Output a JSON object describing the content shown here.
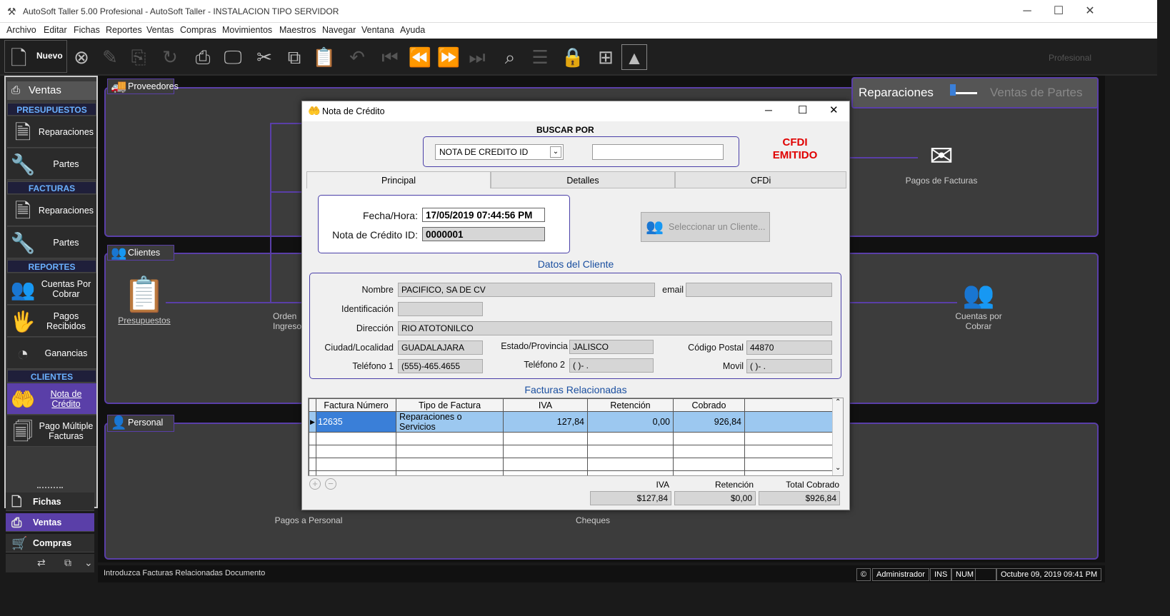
{
  "window": {
    "title": "AutoSoft Taller 5.00 Profesional - AutoSoft Taller - INSTALACION TIPO SERVIDOR",
    "minimize": "─",
    "maximize": "☐",
    "close": "✕"
  },
  "menu": [
    "Archivo",
    "Editar",
    "Fichas",
    "Reportes",
    "Ventas",
    "Compras",
    "Movimientos",
    "Maestros",
    "Navegar",
    "Ventana",
    "Ayuda"
  ],
  "toolbar": {
    "new_label": "Nuevo",
    "brand": "Profesional"
  },
  "sidebar": {
    "header": "Ventas",
    "sections": {
      "presupuestos": "PRESUPUESTOS",
      "facturas": "FACTURAS",
      "reportes": "REPORTES",
      "clientes": "CLIENTES"
    },
    "items": {
      "pres_reparaciones": "Reparaciones",
      "pres_partes": "Partes",
      "fact_reparaciones": "Reparaciones",
      "fact_partes": "Partes",
      "cuentas_cobrar": "Cuentas Por Cobrar",
      "pagos_recibidos": "Pagos Recibidos",
      "ganancias": "Ganancias",
      "nota_credito": "Nota de Crédito",
      "pago_multiple": "Pago Múltiple Facturas"
    },
    "bottom": {
      "fichas": "Fichas",
      "ventas": "Ventas",
      "compras": "Compras"
    }
  },
  "workspace": {
    "panel_proveedores": "Proveedores",
    "panel_clientes": "Clientes",
    "panel_personal": "Personal",
    "toggle": {
      "left": "Reparaciones",
      "right": "Ventas de Partes"
    },
    "icons": {
      "presupuestos": "Presupuestos",
      "ordenes": "Orden Ingreso",
      "pagos_facturas": "Pagos de Facturas",
      "cuentas_cobrar": "Cuentas por Cobrar",
      "pagos_personal": "Pagos a Personal",
      "cheques": "Cheques"
    }
  },
  "modal": {
    "title": "Nota de Crédito",
    "buscar_por": "BUSCAR POR",
    "search_select": "NOTA DE CREDITO ID",
    "search_value": "",
    "cfdi_status_1": "CFDI",
    "cfdi_status_2": "EMITIDO",
    "tabs": [
      "Principal",
      "Detalles",
      "CFDi"
    ],
    "fecha_label": "Fecha/Hora:",
    "fecha_value": "17/05/2019 07:44:56 PM",
    "nota_label": "Nota de Crédito ID:",
    "nota_value": "0000001",
    "select_client": "Seleccionar un Cliente...",
    "datos_cliente": "Datos del Cliente",
    "cliente": {
      "nombre_label": "Nombre",
      "nombre": "PACIFICO, SA DE CV",
      "email_label": "email",
      "email": "",
      "ident_label": "Identificación",
      "ident": "",
      "direccion_label": "Dirección",
      "direccion": "RIO ATOTONILCO",
      "ciudad_label": "Ciudad/Localidad",
      "ciudad": "GUADALAJARA",
      "estado_label": "Estado/Provincia",
      "estado": "JALISCO",
      "cp_label": "Código Postal",
      "cp": "44870",
      "tel1_label": "Teléfono 1",
      "tel1": "(555)-465.4655",
      "tel2_label": "Teléfono 2",
      "tel2": "(  )-   .",
      "movil_label": "Movil",
      "movil": "(  )-   ."
    },
    "facturas_title": "Facturas Relacionadas",
    "columns": [
      "Factura Número",
      "Tipo de Factura",
      "IVA",
      "Retención",
      "Cobrado"
    ],
    "rows": [
      {
        "factura": "12635",
        "tipo": "Reparaciones o Servicios",
        "iva": "127,84",
        "retencion": "0,00",
        "cobrado": "926,84"
      }
    ],
    "totals": {
      "iva_label": "IVA",
      "iva": "$127,84",
      "ret_label": "Retención",
      "ret": "$0,00",
      "total_label": "Total Cobrado",
      "total": "$926,84"
    }
  },
  "status": {
    "message": "Introduzca Facturas Relacionadas Documento",
    "user": "Administrador",
    "ins": "INS",
    "num": "NUM",
    "datetime": "Octubre 09, 2019 09:41 PM"
  },
  "colors": {
    "accent": "#5a3fa8",
    "section_text": "#6ab0ff",
    "cfdi_red": "#e00000",
    "heading_blue": "#1a4fa0",
    "row_select": "#9cc8f0"
  }
}
